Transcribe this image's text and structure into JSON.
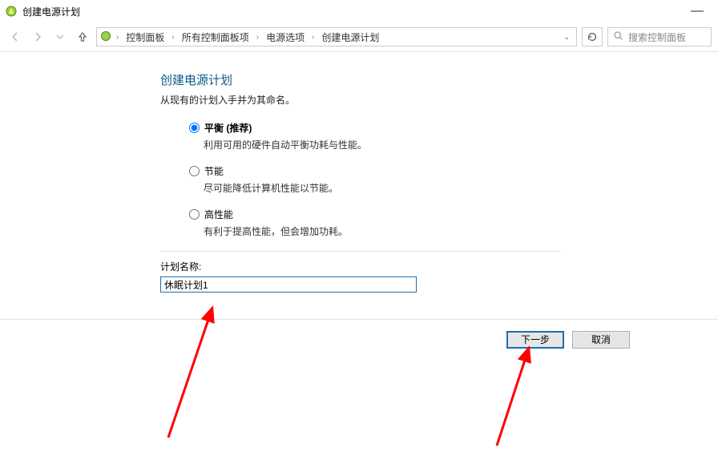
{
  "window": {
    "title": "创建电源计划",
    "minimize": "—"
  },
  "breadcrumb": {
    "items": [
      "控制面板",
      "所有控制面板项",
      "电源选项",
      "创建电源计划"
    ]
  },
  "search": {
    "placeholder": "搜索控制面板"
  },
  "main": {
    "heading": "创建电源计划",
    "subheading": "从现有的计划入手并为其命名。",
    "options": [
      {
        "key": "balanced",
        "label": "平衡 (推荐)",
        "desc": "利用可用的硬件自动平衡功耗与性能。",
        "selected": true
      },
      {
        "key": "saver",
        "label": "节能",
        "desc": "尽可能降低计算机性能以节能。",
        "selected": false
      },
      {
        "key": "high",
        "label": "高性能",
        "desc": "有利于提高性能，但会增加功耗。",
        "selected": false
      }
    ],
    "plan_name_label": "计划名称:",
    "plan_name_value": "休眠计划1"
  },
  "footer": {
    "next": "下一步",
    "cancel": "取消"
  }
}
